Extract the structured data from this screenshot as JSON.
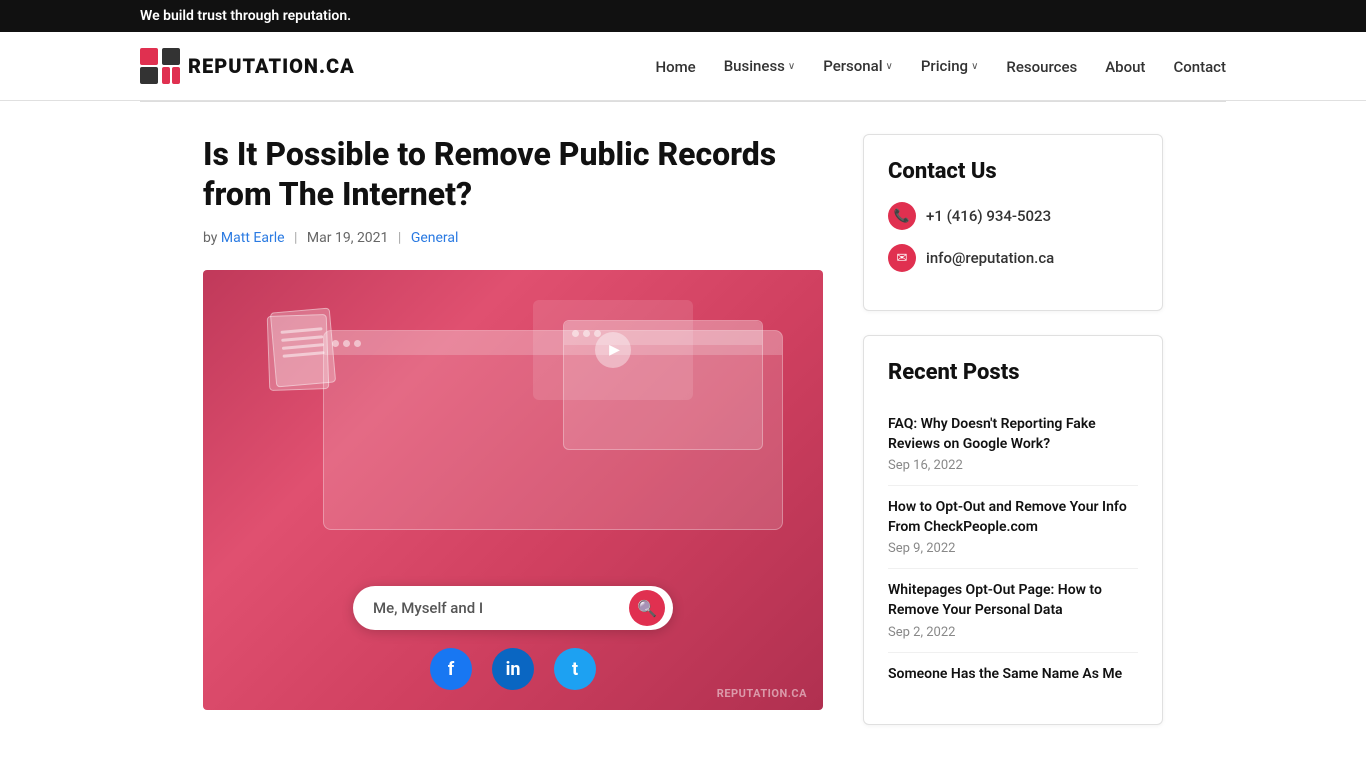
{
  "topbar": {
    "tagline": "We build trust through reputation."
  },
  "header": {
    "logo_text": "REPUTATION.CA",
    "nav": [
      {
        "id": "home",
        "label": "Home",
        "hasDropdown": false
      },
      {
        "id": "business",
        "label": "Business",
        "hasDropdown": true
      },
      {
        "id": "personal",
        "label": "Personal",
        "hasDropdown": true
      },
      {
        "id": "pricing",
        "label": "Pricing",
        "hasDropdown": true
      },
      {
        "id": "resources",
        "label": "Resources",
        "hasDropdown": false
      },
      {
        "id": "about",
        "label": "About",
        "hasDropdown": false
      },
      {
        "id": "contact",
        "label": "Contact",
        "hasDropdown": false
      }
    ]
  },
  "article": {
    "title": "Is It Possible to Remove Public Records from The Internet?",
    "author": "Matt Earle",
    "date": "Mar 19, 2021",
    "category": "General",
    "by_label": "by",
    "search_placeholder": "Me, Myself and I",
    "watermark": "REPUTATION.CA"
  },
  "sidebar": {
    "contact_card": {
      "title": "Contact Us",
      "phone": "+1 (416) 934-5023",
      "email": "info@reputation.ca"
    },
    "recent_posts": {
      "title": "Recent Posts",
      "posts": [
        {
          "title": "FAQ: Why Doesn't Reporting Fake Reviews on Google Work?",
          "date": "Sep 16, 2022"
        },
        {
          "title": "How to Opt-Out and Remove Your Info From CheckPeople.com",
          "date": "Sep 9, 2022"
        },
        {
          "title": "Whitepages Opt-Out Page: How to Remove Your Personal Data",
          "date": "Sep 2, 2022"
        },
        {
          "title": "Someone Has the Same Name As Me",
          "date": ""
        }
      ]
    }
  },
  "icons": {
    "phone": "📞",
    "email": "✉",
    "search": "🔍",
    "play": "▶",
    "facebook": "f",
    "linkedin": "in",
    "twitter": "t",
    "chevron": "›"
  }
}
